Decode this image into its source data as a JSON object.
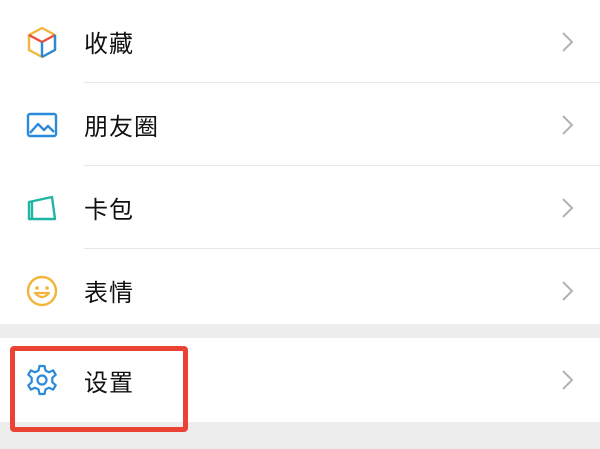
{
  "menu": {
    "items": [
      {
        "label": "收藏",
        "icon": "favorites-cube-icon"
      },
      {
        "label": "朋友圈",
        "icon": "moments-picture-icon"
      },
      {
        "label": "卡包",
        "icon": "card-wallet-icon"
      },
      {
        "label": "表情",
        "icon": "emoji-smile-icon"
      }
    ]
  },
  "settings": {
    "label": "设置",
    "icon": "gear-icon"
  },
  "colors": {
    "highlight": "#ea4335",
    "accent_blue": "#2b8ad9",
    "background": "#ededed"
  }
}
